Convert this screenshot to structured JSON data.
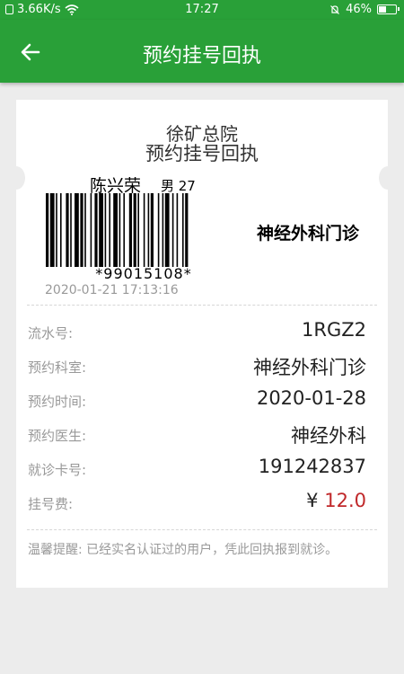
{
  "status_bar": {
    "net_speed": "3.66K/s",
    "time": "17:27",
    "battery": "46%",
    "battery_level": 0.46
  },
  "app_bar": {
    "title": "预约挂号回执"
  },
  "receipt": {
    "hospital": "徐矿总院",
    "title": "预约挂号回执",
    "patient_name": "陈兴荣",
    "patient_meta": "男 27",
    "barcode_number": "*99015108*",
    "department_bold": "神经外科门诊",
    "timestamp": "2020-01-21 17:13:16",
    "rows": [
      {
        "label": "流水号:",
        "value": "1RGZ2"
      },
      {
        "label": "预约科室:",
        "value": "神经外科门诊"
      },
      {
        "label": "预约时间:",
        "value": "2020-01-28"
      },
      {
        "label": "预约医生:",
        "value": "神经外科"
      },
      {
        "label": "就诊卡号:",
        "value": "191242837"
      }
    ],
    "fee": {
      "label": "挂号费:",
      "symbol": "¥",
      "amount": "12.0"
    },
    "reminder": "温馨提醒: 已经实名认证过的用户，凭此回执报到就诊。"
  },
  "colors": {
    "brand": "#29a038",
    "fee": "#c0282a",
    "background": "#ececec"
  }
}
